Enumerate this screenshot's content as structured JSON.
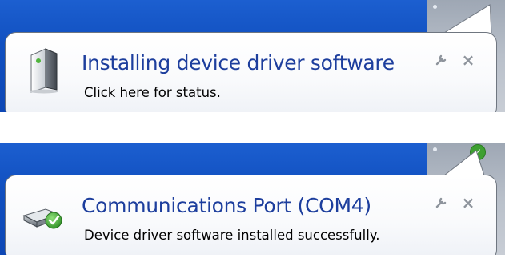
{
  "notifications": [
    {
      "title": "Installing device driver software",
      "message": "Click here for status.",
      "icon": "tower-computer-icon",
      "status_badge": ""
    },
    {
      "title": "Communications Port (COM4)",
      "message": "Device driver software installed successfully.",
      "icon": "device-success-icon",
      "status_badge": "✓"
    }
  ],
  "buttons": {
    "options_icon": "wrench-icon",
    "close_glyph": "×"
  },
  "colors": {
    "title": "#1d3e9d",
    "desktop": "#1150c0",
    "tray": "#b9c0ca",
    "success": "#3ea031"
  }
}
